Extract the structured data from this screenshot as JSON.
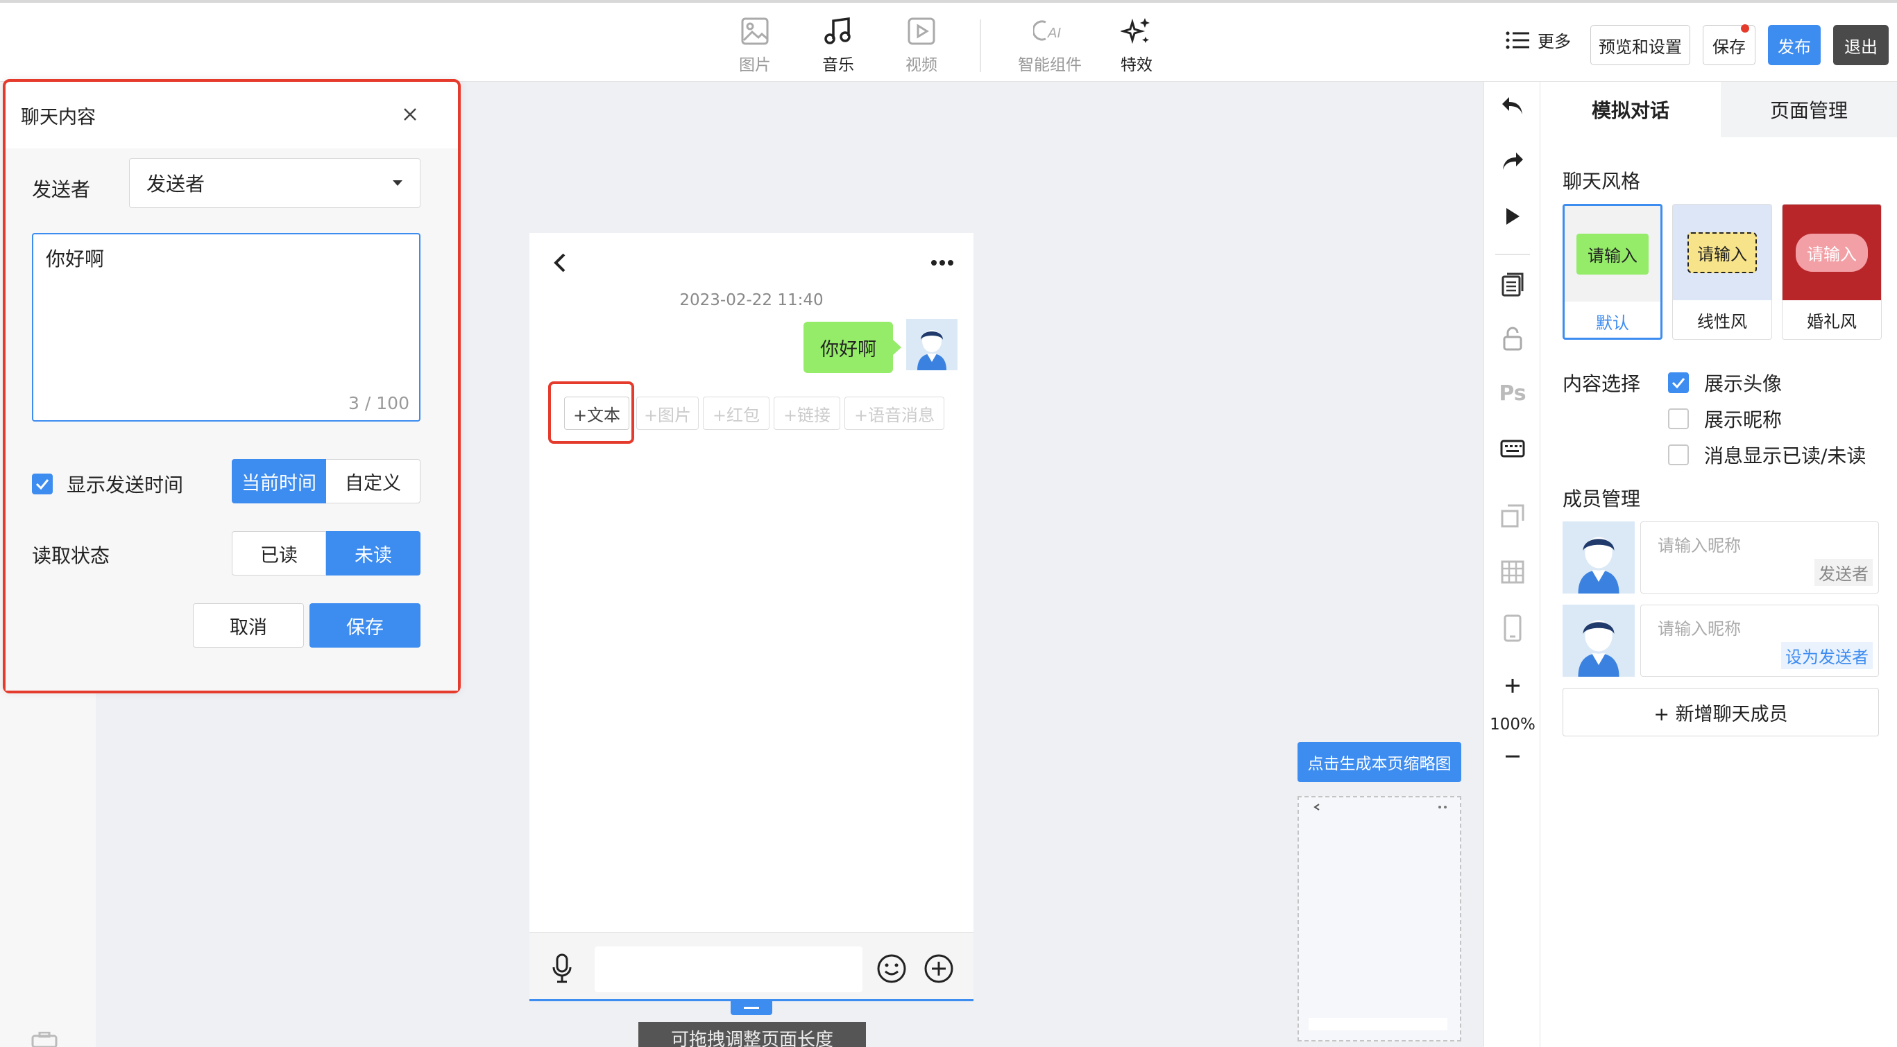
{
  "toolbar": {
    "tools": [
      {
        "label": "图片",
        "icon": "image-icon"
      },
      {
        "label": "音乐",
        "icon": "music-icon"
      },
      {
        "label": "视频",
        "icon": "video-icon"
      },
      {
        "label": "智能组件",
        "icon": "ai-component-icon"
      },
      {
        "label": "特效",
        "icon": "sparkle-icon"
      }
    ],
    "more_label": "更多",
    "preview_label": "预览和设置",
    "save_label": "保存",
    "publish_label": "发布",
    "exit_label": "退出"
  },
  "dialog": {
    "title": "聊天内容",
    "sender_label": "发送者",
    "sender_value": "发送者",
    "message_text": "你好啊",
    "char_count": "3 / 100",
    "show_time_label": "显示发送时间",
    "show_time_checked": true,
    "time_options": [
      "当前时间",
      "自定义"
    ],
    "time_selected": "当前时间",
    "read_state_label": "读取状态",
    "read_options": [
      "已读",
      "未读"
    ],
    "read_selected": "未读",
    "cancel_label": "取消",
    "save_label": "保存"
  },
  "phone": {
    "timestamp": "2023-02-22 11:40",
    "message": "你好啊",
    "add_buttons": [
      "+文本",
      "+图片",
      "+红包",
      "+链接",
      "+语音消息"
    ],
    "drag_hint": "可拖拽调整页面长度"
  },
  "thumbnail": {
    "generate_label": "点击生成本页缩略图"
  },
  "vertical_tools": {
    "zoom": "100%",
    "items": [
      "undo-icon",
      "redo-icon",
      "play-icon",
      "layers-icon",
      "unlock-icon",
      "ps-icon",
      "keyboard-icon",
      "copy-page-icon",
      "grid-icon",
      "phone-icon",
      "zoom-in-icon",
      "zoom-out-icon"
    ],
    "ps_text": "Ps"
  },
  "right_panel": {
    "tabs": [
      "模拟对话",
      "页面管理"
    ],
    "active_tab": "模拟对话",
    "chat_style_label": "聊天风格",
    "styles": [
      {
        "name": "默认",
        "sample": "请输入",
        "selected": true
      },
      {
        "name": "线性风",
        "sample": "请输入",
        "selected": false
      },
      {
        "name": "婚礼风",
        "sample": "请输入",
        "selected": false
      }
    ],
    "content_select_label": "内容选择",
    "options": [
      {
        "label": "展示头像",
        "checked": true
      },
      {
        "label": "展示昵称",
        "checked": false
      },
      {
        "label": "消息显示已读/未读",
        "checked": false
      }
    ],
    "member_label": "成员管理",
    "members": [
      {
        "placeholder": "请输入昵称",
        "tag": "发送者"
      },
      {
        "placeholder": "请输入昵称",
        "tag": "设为发送者"
      }
    ],
    "add_member_label": "+ 新增聊天成员"
  },
  "colors": {
    "accent": "#3d8cf0",
    "highlight": "#e53b2d",
    "bubble": "#95ec69",
    "exit": "#4a4a4a"
  }
}
